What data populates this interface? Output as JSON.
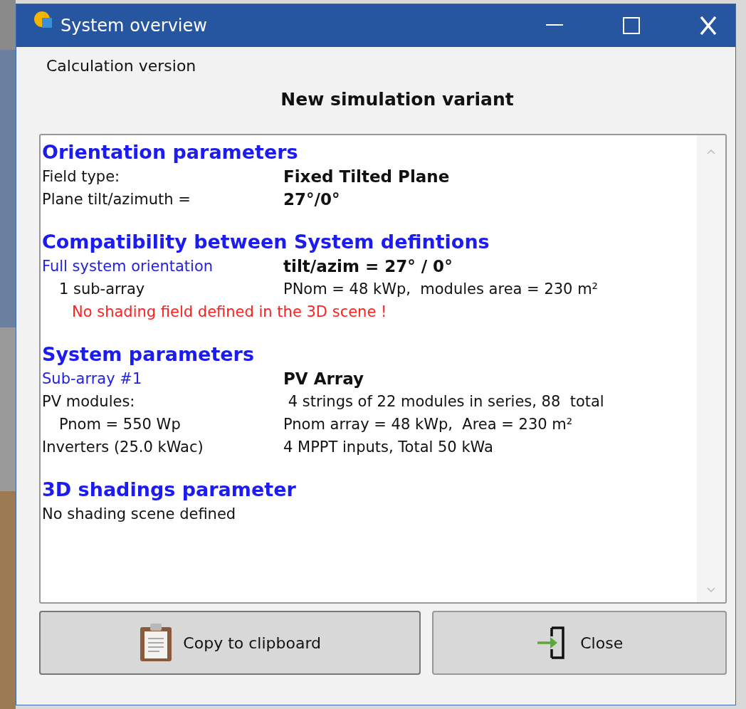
{
  "window": {
    "title": "System overview"
  },
  "menu": {
    "label": "Calculation version"
  },
  "heading": "New simulation variant",
  "sections": [
    {
      "title": "Orientation parameters",
      "rows": [
        {
          "kind": "pair",
          "label": "Field type:",
          "value": "Fixed Tilted Plane",
          "highlight": false,
          "bold": true,
          "indented": false
        },
        {
          "kind": "pair",
          "label": "Plane tilt/azimuth =",
          "value": "27°/0°",
          "highlight": false,
          "bold": true,
          "indented": false
        }
      ]
    },
    {
      "title": "Compatibility between System defintions",
      "rows": [
        {
          "kind": "pair",
          "label": "Full system orientation",
          "value": "tilt/azim = 27° / 0°",
          "highlight": true,
          "bold": true,
          "indented": false
        },
        {
          "kind": "pair",
          "label": "1 sub-array",
          "value": "PNom = 48 kWp,  modules area = 230 m²",
          "highlight": false,
          "bold": false,
          "indented": true
        },
        {
          "kind": "warning",
          "label": "No shading field defined in the 3D scene !"
        }
      ]
    },
    {
      "title": "System parameters",
      "rows": [
        {
          "kind": "pair",
          "label": "Sub-array #1",
          "value": "PV Array",
          "highlight": true,
          "bold": true,
          "indented": false
        },
        {
          "kind": "pair",
          "label": "PV modules:",
          "value": " 4 strings of 22 modules in series, 88  total",
          "highlight": false,
          "bold": false,
          "indented": false
        },
        {
          "kind": "pair",
          "label": "Pnom = 550 Wp",
          "value": "Pnom array = 48 kWp,  Area = 230 m²",
          "highlight": false,
          "bold": false,
          "indented": true
        },
        {
          "kind": "pair",
          "label": "Inverters (25.0 kWac)",
          "value": "4 MPPT inputs, Total 50 kWa",
          "highlight": false,
          "bold": false,
          "indented": false
        }
      ]
    },
    {
      "title": "3D shadings parameter",
      "rows": [
        {
          "kind": "text",
          "label": "No shading scene defined"
        }
      ]
    }
  ],
  "buttons": [
    {
      "kind": "copy",
      "label": "Copy to clipboard"
    },
    {
      "kind": "close",
      "label": "Close"
    }
  ]
}
